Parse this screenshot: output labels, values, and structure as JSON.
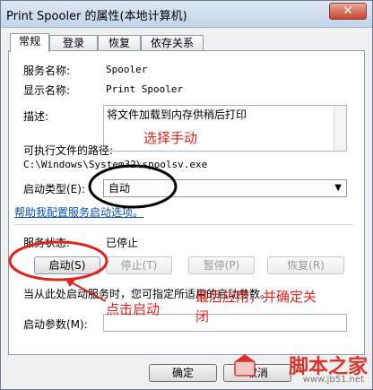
{
  "window": {
    "title": "Print Spooler 的属性(本地计算机)",
    "close_label": "✕"
  },
  "tabs": [
    {
      "label": "常规",
      "active": true
    },
    {
      "label": "登录",
      "active": false
    },
    {
      "label": "恢复",
      "active": false
    },
    {
      "label": "依存关系",
      "active": false
    }
  ],
  "general": {
    "service_name_label": "服务名称:",
    "service_name": "Spooler",
    "display_name_label": "显示名称:",
    "display_name": "Print Spooler",
    "description_label": "描述:",
    "description": "将文件加载到内存供稍后打印",
    "exe_path_label": "可执行文件的路径:",
    "exe_path": "C:\\Windows\\System32\\spoolsv.exe",
    "startup_type_label": "启动类型(E):",
    "startup_type": "自动",
    "help_link": "帮助我配置服务启动选项。",
    "status_label": "服务状态:",
    "status": "已停止",
    "buttons": {
      "start": "启动(S)",
      "stop": "停止(T)",
      "pause": "暂停(P)",
      "resume": "恢复(R)"
    },
    "hint": "当从此处启动服务时，您可指定所适用的启动参数。",
    "start_params_label": "启动参数(M):",
    "start_params_value": ""
  },
  "footer": {
    "ok": "确定",
    "cancel": "取消"
  },
  "annotations": {
    "select_manual": "选择手动",
    "click_start": "点击启动",
    "apply_line1": "最后应用，并确定关",
    "apply_line2": "闭",
    "color": "#e0231c"
  },
  "watermark": {
    "title": "脚本之家",
    "url": "www.jb51.net"
  }
}
